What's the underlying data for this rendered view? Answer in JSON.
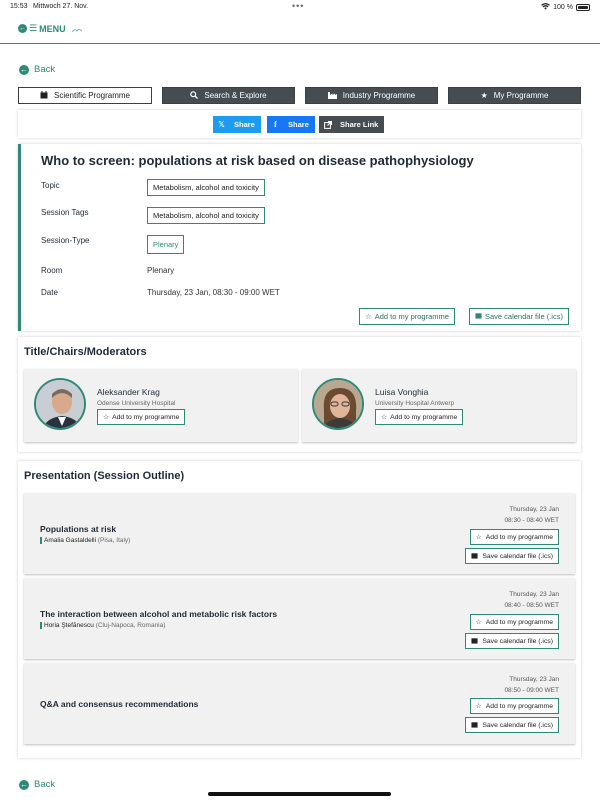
{
  "status_bar": {
    "time": "15:53",
    "date": "Mittwoch 27. Nov.",
    "dots": "•••",
    "battery": "100 %"
  },
  "topbar": {
    "menu_label": "MENU"
  },
  "back_label": "Back",
  "nav": [
    {
      "label": "Scientific Programme",
      "icon": "calendar-icon"
    },
    {
      "label": "Search & Explore",
      "icon": "search-icon"
    },
    {
      "label": "Industry Programme",
      "icon": "industry-icon"
    },
    {
      "label": "My Programme",
      "icon": "star-icon"
    }
  ],
  "share": {
    "x_label": "Share",
    "facebook_label": "Share",
    "link_label": "Share Link"
  },
  "session": {
    "title": "Who to screen: populations at risk based on disease pathophysiology",
    "topic_label": "Topic",
    "topic_value": "Metabolism, alcohol and toxicity",
    "tags_label": "Session Tags",
    "tags_value": "Metabolism, alcohol and toxicity",
    "type_label": "Session-Type",
    "type_value": "Plenary",
    "room_label": "Room",
    "room_value": "Plenary",
    "date_label": "Date",
    "date_value": "Thursday, 23 Jan, 08:30 - 09:00 WET",
    "add_label": "Add to my programme",
    "ics_label": "Save calendar file (.ics)"
  },
  "chairs": {
    "heading": "Title/Chairs/Moderators",
    "people": [
      {
        "name": "Aleksander Krag",
        "affiliation": "Odense University Hospital",
        "add_label": "Add to my programme"
      },
      {
        "name": "Luisa Vonghia",
        "affiliation": "University Hospital Antwerp",
        "add_label": "Add to my programme"
      }
    ]
  },
  "outline": {
    "heading": "Presentation (Session Outline)",
    "items": [
      {
        "title": "Populations at risk",
        "author": "Amalia Gastaldelli",
        "location": "(Pisa, Italy)",
        "date": "Thursday, 23 Jan",
        "time": "08:30 - 08:40 WET",
        "add_label": "Add to my programme",
        "ics_label": "Save calendar file (.ics)"
      },
      {
        "title": "The interaction between alcohol and metabolic risk factors",
        "author": "Horia Ştefănescu",
        "location": "(Cluj-Napoca, Romania)",
        "date": "Thursday, 23 Jan",
        "time": "08:40 - 08:50 WET",
        "add_label": "Add to my programme",
        "ics_label": "Save calendar file (.ics)"
      },
      {
        "title": "Q&A and consensus recommendations",
        "author": "",
        "location": "",
        "date": "Thursday, 23 Jan",
        "time": "08:50 - 09:00 WET",
        "add_label": "Add to my programme",
        "ics_label": "Save calendar file (.ics)"
      }
    ]
  },
  "colors": {
    "accent": "#2e8a76",
    "dark_button": "#474c51",
    "x_blue": "#1d9bf0",
    "facebook_blue": "#1877f2"
  }
}
